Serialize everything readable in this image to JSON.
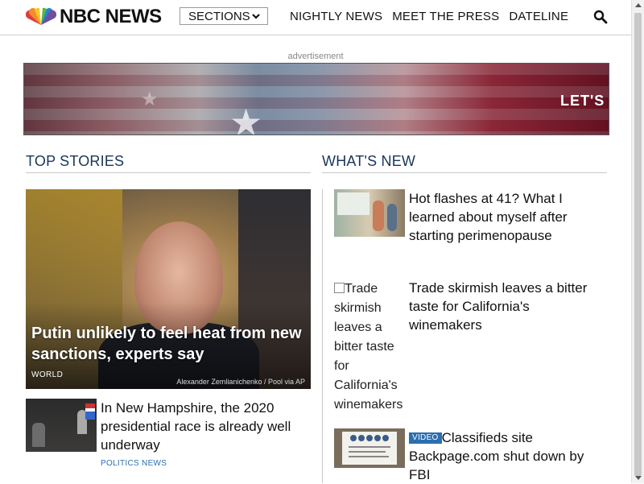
{
  "header": {
    "logo_text": "NBC NEWS",
    "sections_label": "SECTIONS",
    "nav": [
      "NIGHTLY NEWS",
      "MEET THE PRESS",
      "DATELINE"
    ]
  },
  "ad": {
    "label": "advertisement",
    "banner_text": "LET'S S"
  },
  "top_stories": {
    "heading": "TOP STORIES",
    "hero": {
      "title": "Putin unlikely to feel heat from new sanctions, experts say",
      "tag": "WORLD",
      "credit": "Alexander Zemlianichenko / Pool via AP"
    },
    "items": [
      {
        "title": "In New Hampshire, the 2020 presidential race is already well underway",
        "tag": "POLITICS NEWS"
      }
    ]
  },
  "whats_new": {
    "heading": "WHAT'S NEW",
    "items": [
      {
        "title": "Hot flashes at 41? What I learned about myself after starting perimenopause"
      },
      {
        "title": "Trade skirmish leaves a bitter taste for California's winemakers",
        "alt": "Trade skirmish leaves a bitter taste for California's winemakers"
      },
      {
        "badge": "VIDEO",
        "title": "Classifieds site Backpage.com shut down by FBI"
      }
    ]
  },
  "colors": {
    "heading": "#1a3656",
    "link_tag": "#2b6fb0"
  }
}
